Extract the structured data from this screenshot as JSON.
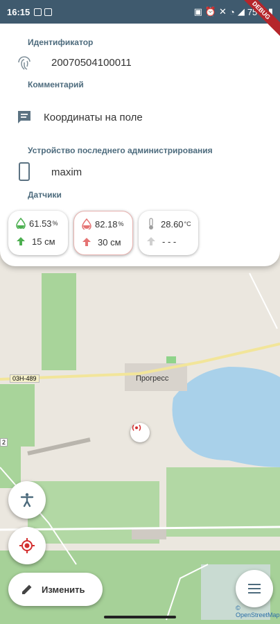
{
  "status_bar": {
    "time": "16:15",
    "battery": "75%"
  },
  "debug_ribbon": "DEBUG",
  "card": {
    "identifier_label": "Идентификатор",
    "identifier_value": "20070504100011",
    "comment_label": "Комментарий",
    "comment_value": "Координаты на поле",
    "device_label": "Устройство последнего администрирования",
    "device_value": "maxim",
    "sensors_label": "Датчики"
  },
  "sensors": [
    {
      "value": "61.53",
      "unit": "%",
      "depth": "15 см",
      "color": "#4caf50"
    },
    {
      "value": "82.18",
      "unit": "%",
      "depth": "30 см",
      "color": "#e57373"
    },
    {
      "value": "28.60",
      "unit": "°C",
      "depth": "- - -",
      "color": "#9e9e9e"
    }
  ],
  "map": {
    "road_label": "03Н-489",
    "town_label": "Прогресс",
    "edge_label": "2",
    "attribution": "© OpenStreetMap"
  },
  "actions": {
    "edit_label": "Изменить"
  },
  "colors": {
    "accent": "#d32f2f",
    "label": "#4d6b7d",
    "status_bar": "#3f5a6e"
  }
}
